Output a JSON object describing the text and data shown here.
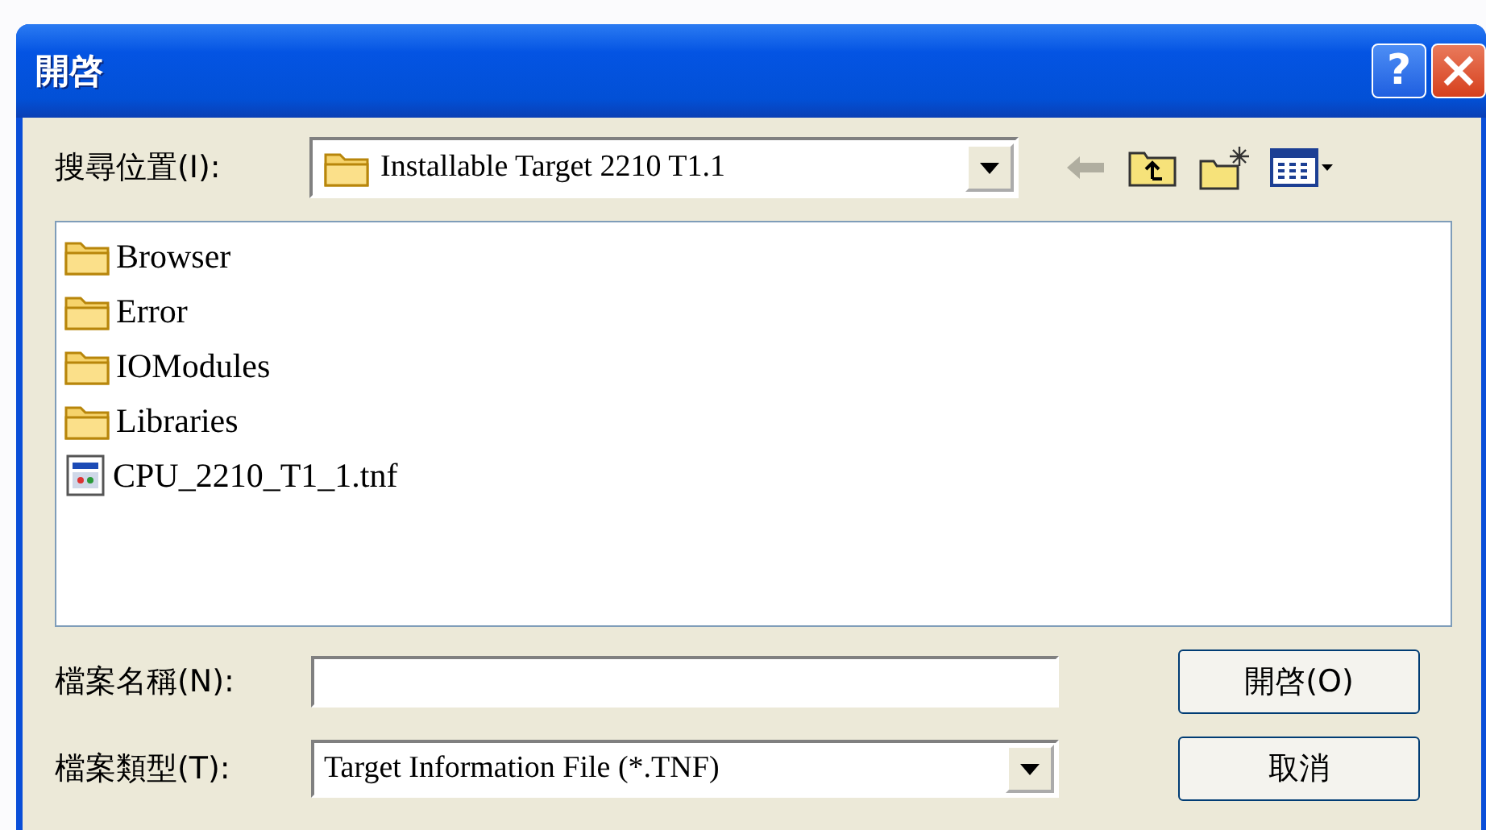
{
  "window": {
    "title": "開啓"
  },
  "look_in": {
    "label": "搜尋位置(I):",
    "value": "Installable Target 2210 T1.1"
  },
  "files": [
    {
      "name": "Browser",
      "kind": "folder",
      "selected": false
    },
    {
      "name": "Error",
      "kind": "folder",
      "selected": false
    },
    {
      "name": "IOModules",
      "kind": "folder",
      "selected": false
    },
    {
      "name": "Libraries",
      "kind": "folder",
      "selected": false
    },
    {
      "name": "CPU_2210_T1_1.tnf",
      "kind": "file",
      "selected": false
    }
  ],
  "file_name": {
    "label": "檔案名稱(N):"
  },
  "file_type": {
    "label": "檔案類型(T):",
    "value": "Target Information File (*.TNF)"
  },
  "buttons": {
    "open": "開啓(O)",
    "cancel": "取消"
  },
  "title_buttons": {
    "help": "?"
  }
}
